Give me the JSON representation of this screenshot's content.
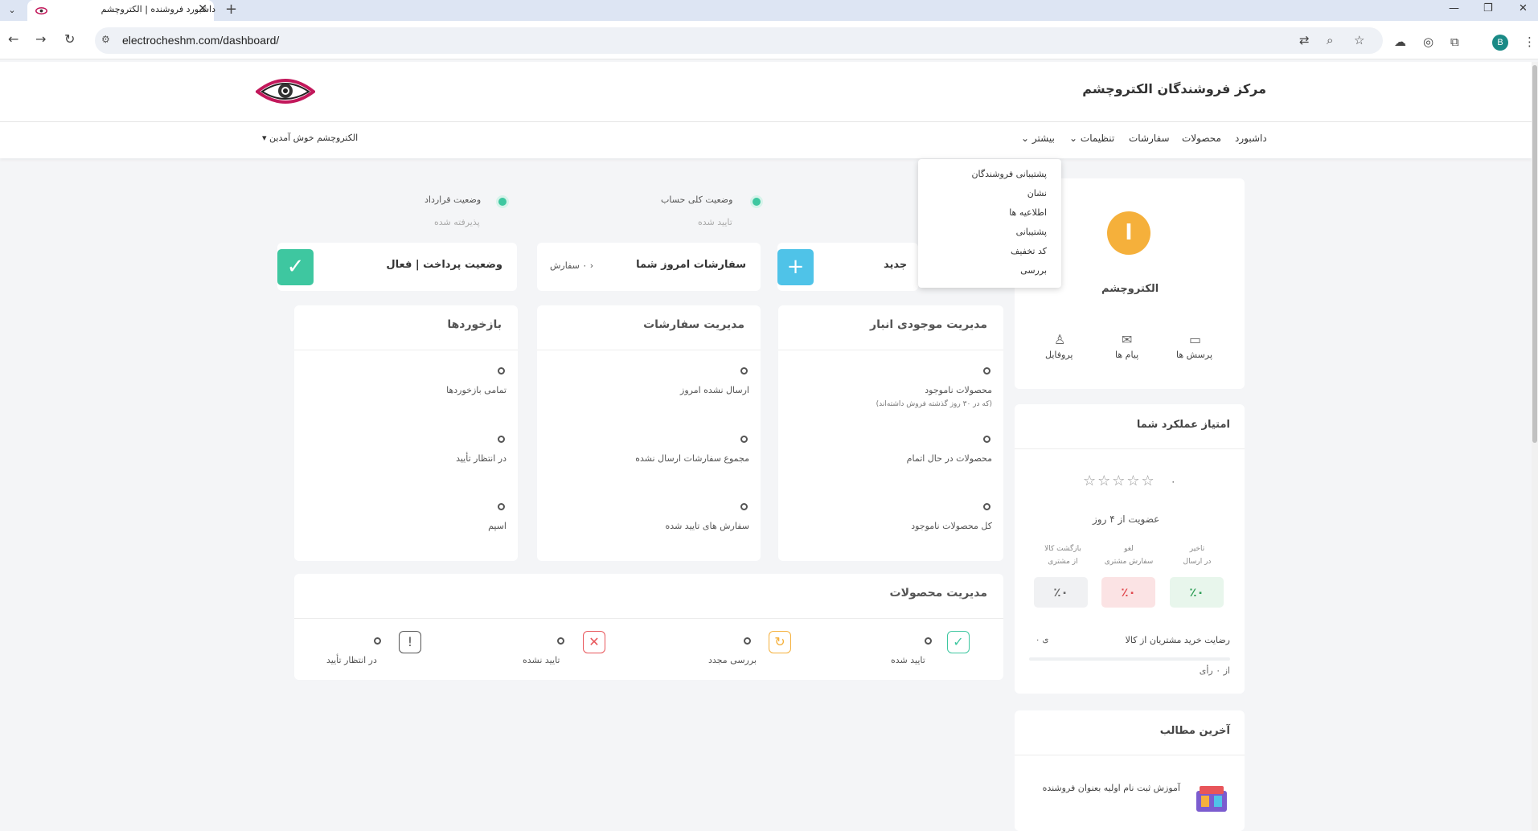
{
  "browser": {
    "tab_title": "داشبورد فروشنده | الکتروچشم",
    "url": "electrocheshm.com/dashboard/",
    "profile_initial": "B"
  },
  "header": {
    "site_title": "مرکز فروشندگان الکتروچشم",
    "welcome": "الکتروچشم خوش آمدین"
  },
  "nav": {
    "items": [
      "داشبورد",
      "محصولات",
      "سفارشات",
      "تنظیمات",
      "بیشتر"
    ]
  },
  "dropdown": {
    "items": [
      "پشتیبانی فروشندگان",
      "نشان",
      "اطلاعیه ها",
      "پشتیبانی",
      "کد تخفیف",
      "بررسی"
    ]
  },
  "status": {
    "contract_label": "وضعیت قرارداد",
    "contract_value": "پذیرفته شده",
    "account_label": "وضعیت کلی حساب",
    "account_value": "تایید شده"
  },
  "stats": {
    "payment_title": "وضعیت پرداخت | فعال",
    "orders_today_title": "سفارشات امروز شما",
    "orders_today_count": "۰ سفارش",
    "new_product_title": "جدید"
  },
  "panels": {
    "feedback": {
      "title": "بازخوردها",
      "items": [
        "تمامی بازخوردها",
        "در انتظار تأیید",
        "اسپم"
      ],
      "values": [
        "۰",
        "۰",
        "۰"
      ]
    },
    "orders": {
      "title": "مدیریت سفارشات",
      "items": [
        "ارسال نشده امروز",
        "مجموع سفارشات ارسال نشده",
        "سفارش های تایید شده"
      ],
      "values": [
        "۰",
        "۰",
        "۰"
      ]
    },
    "inventory": {
      "title": "مدیریت موجودی انبار",
      "items": [
        "محصولات ناموجود",
        "محصولات در حال اتمام",
        "کل محصولات ناموجود"
      ],
      "note": "(که در ۳۰ روز گذشته فروش داشته‌اند)",
      "values": [
        "۰",
        "۰",
        "۰"
      ]
    },
    "products": {
      "title": "مدیریت محصولات",
      "items": [
        "تایید شده",
        "بررسی مجدد",
        "تایید نشده",
        "در انتظار تأیید"
      ],
      "values": [
        "۰",
        "۰",
        "۰",
        "۰"
      ],
      "colors": [
        "#3ec7a0",
        "#f5b03b",
        "#e8555a",
        "#555555"
      ]
    }
  },
  "sidebar": {
    "vendor_initial": "ا",
    "vendor_name": "الکتروچشم",
    "actions": [
      "پرسش ها",
      "پیام ها",
      "پروفایل"
    ],
    "performance_title": "امتیاز عملکرد شما",
    "rating_value": "۰",
    "membership": "عضویت از ۴ روز",
    "metrics": [
      {
        "head1": "تاخیر",
        "head2": "در ارسال",
        "value": "٪۰",
        "color": "#2f9e57",
        "bg": "#e8f6ec"
      },
      {
        "head1": "لغو",
        "head2": "سفارش مشتری",
        "value": "٪۰",
        "color": "#e0484d",
        "bg": "#fbe3e4"
      },
      {
        "head1": "بازگشت کالا",
        "head2": "از مشتری",
        "value": "٪۰",
        "color": "#666666",
        "bg": "#f0f1f3"
      }
    ],
    "satisfaction_label": "رضایت خرید مشتریان از کالا",
    "satisfaction_value": "۰",
    "votes": "از ۰ رأی",
    "latest_title": "آخرین مطالب",
    "latest_item": "آموزش ثبت نام اولیه بعنوان فروشنده"
  },
  "colors": {
    "accent_green": "#3ec7a0",
    "accent_blue": "#4fc3e8",
    "vendor_orange": "#f5b03b"
  }
}
